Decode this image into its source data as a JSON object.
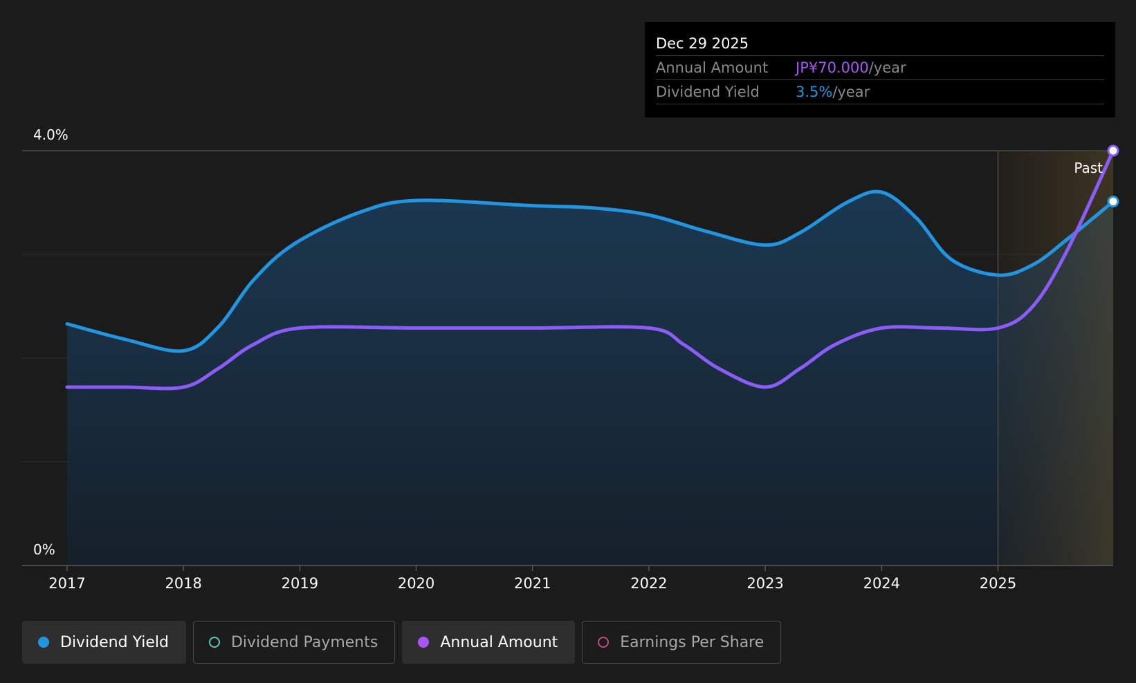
{
  "tooltip": {
    "date": "Dec 29 2025",
    "rows": [
      {
        "label": "Annual Amount",
        "value": "JP¥70.000",
        "unit": "/year",
        "color": "#a855f7"
      },
      {
        "label": "Dividend Yield",
        "value": "3.5%",
        "unit": "/year",
        "color": "#2394df"
      }
    ]
  },
  "legend": [
    {
      "label": "Dividend Yield",
      "active": true,
      "color": "#2394df",
      "icon": "filled-circle"
    },
    {
      "label": "Dividend Payments",
      "active": false,
      "color": "#5fc9b8",
      "icon": "hollow-circle"
    },
    {
      "label": "Annual Amount",
      "active": true,
      "color": "#a855f7",
      "icon": "filled-circle"
    },
    {
      "label": "Earnings Per Share",
      "active": false,
      "color": "#c2497f",
      "icon": "hollow-circle"
    }
  ],
  "chart_data": {
    "type": "line",
    "y_tick_labels": [
      "4.0%",
      "0%"
    ],
    "ylim": [
      0,
      4.0
    ],
    "xlim": [
      2017.0,
      2025.99
    ],
    "x_ticks": [
      2017,
      2018,
      2019,
      2020,
      2021,
      2022,
      2023,
      2024,
      2025
    ],
    "grid": true,
    "past_label": "Past",
    "past_region_start": 2025.0,
    "series": [
      {
        "name": "Dividend Yield",
        "color": "#2394df",
        "area": true,
        "x": [
          2017.0,
          2017.5,
          2018.0,
          2018.3,
          2018.6,
          2018.95,
          2019.5,
          2020.0,
          2021.0,
          2021.5,
          2022.0,
          2022.5,
          2023.0,
          2023.3,
          2023.7,
          2024.0,
          2024.3,
          2024.6,
          2025.0,
          2025.3,
          2025.6,
          2025.99
        ],
        "y": [
          2.33,
          2.18,
          2.07,
          2.3,
          2.75,
          3.1,
          3.4,
          3.52,
          3.47,
          3.45,
          3.38,
          3.22,
          3.09,
          3.21,
          3.5,
          3.6,
          3.35,
          2.95,
          2.8,
          2.9,
          3.15,
          3.51
        ]
      },
      {
        "name": "Annual Amount",
        "color": "#8b5cf6",
        "area": false,
        "x": [
          2017.0,
          2017.5,
          2018.0,
          2018.3,
          2018.6,
          2019.0,
          2020.0,
          2021.0,
          2022.0,
          2022.3,
          2022.6,
          2023.0,
          2023.3,
          2023.6,
          2024.0,
          2024.5,
          2025.0,
          2025.3,
          2025.6,
          2025.99
        ],
        "y": [
          1.72,
          1.72,
          1.72,
          1.9,
          2.13,
          2.29,
          2.29,
          2.29,
          2.29,
          2.13,
          1.9,
          1.72,
          1.9,
          2.13,
          2.29,
          2.29,
          2.29,
          2.5,
          3.05,
          4.0
        ]
      }
    ]
  }
}
